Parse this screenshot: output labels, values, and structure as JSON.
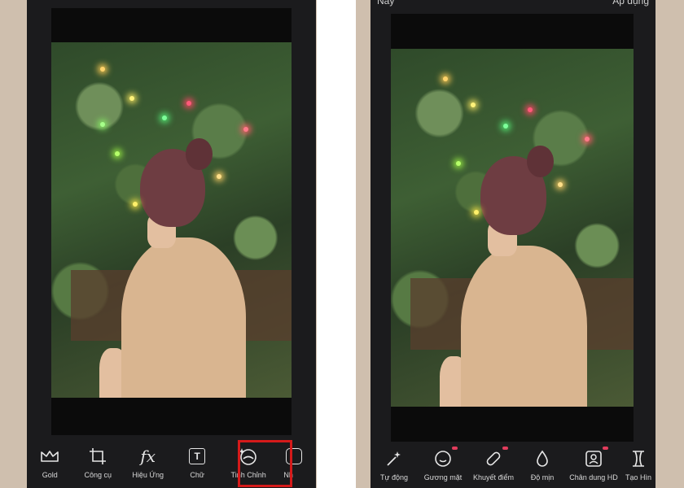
{
  "left_screen": {
    "toolbar": [
      {
        "label": "Gold",
        "icon": "crown-icon"
      },
      {
        "label": "Công cụ",
        "icon": "crop-icon"
      },
      {
        "label": "Hiệu Ứng",
        "icon": "fx-icon",
        "glyph": "fx"
      },
      {
        "label": "Chữ",
        "icon": "text-icon",
        "glyph": "T"
      },
      {
        "label": "Tinh Chỉnh",
        "icon": "retouch-face-icon"
      },
      {
        "label": "Nh",
        "icon": "sticker-icon"
      }
    ],
    "highlighted_tool": "Tinh Chỉnh"
  },
  "right_screen": {
    "top_bar": {
      "left_text": "Nay",
      "right_text": "Áp dụng"
    },
    "toolbar": [
      {
        "label": "Tự động",
        "icon": "magic-wand-icon"
      },
      {
        "label": "Gương mặt",
        "icon": "face-icon",
        "badge": true
      },
      {
        "label": "Khuyết điểm",
        "icon": "bandage-icon",
        "badge": true
      },
      {
        "label": "Độ mịn",
        "icon": "drop-icon"
      },
      {
        "label": "Chân dung HD",
        "icon": "portrait-hd-icon",
        "badge": true
      },
      {
        "label": "Tạo Hìn",
        "icon": "body-shape-icon"
      }
    ]
  },
  "colors": {
    "background": "#cfbfae",
    "phone": "#1b1b1d",
    "highlight": "#d51a1a",
    "badge": "#e23c5c"
  }
}
